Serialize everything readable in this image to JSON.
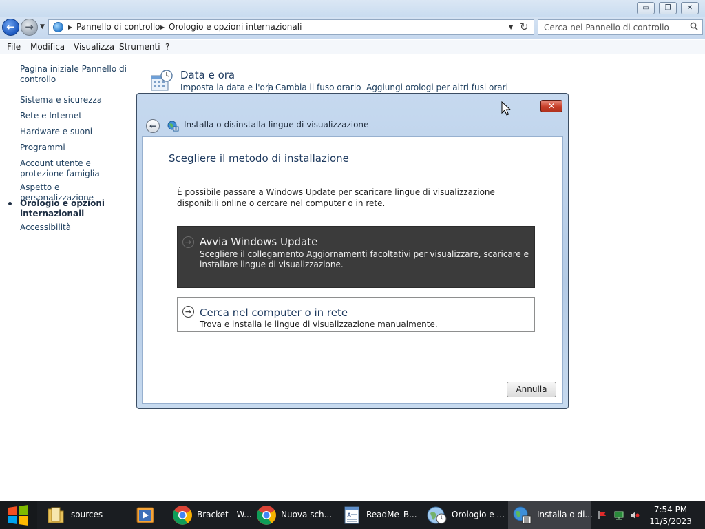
{
  "window": {
    "minimize_glyph": "▭",
    "restore_glyph": "❐",
    "close_glyph": "✕"
  },
  "address_bar": {
    "breadcrumbs": [
      "Pannello di controllo",
      "Orologio e opzioni internazionali"
    ],
    "search_placeholder": "Cerca nel Pannello di controllo"
  },
  "menu": [
    "File",
    "Modifica",
    "Visualizza",
    "Strumenti",
    "?"
  ],
  "sidebar": {
    "items": [
      {
        "label": "Pagina iniziale Pannello di controllo"
      },
      {
        "label": "Sistema e sicurezza"
      },
      {
        "label": "Rete e Internet"
      },
      {
        "label": "Hardware e suoni"
      },
      {
        "label": "Programmi"
      },
      {
        "label": "Account utente e protezione famiglia"
      },
      {
        "label": "Aspetto e personalizzazione"
      },
      {
        "label": "Orologio e opzioni internazionali",
        "active": true
      },
      {
        "label": "Accessibilità"
      }
    ]
  },
  "category": {
    "title": "Data e ora",
    "links": [
      "Imposta la data e l'ora",
      "Cambia il fuso orario",
      "Aggiungi orologi per altri fusi orari"
    ]
  },
  "dialog": {
    "title": "Installa o disinstalla lingue di visualizzazione",
    "heading": "Scegliere il metodo di installazione",
    "description": "È possibile passare a Windows Update per scaricare lingue di visualizzazione disponibili online o cercare nel computer o in rete.",
    "options": [
      {
        "title": "Avvia Windows Update",
        "description": "Scegliere il collegamento Aggiornamenti facoltativi per visualizzare, scaricare e installare lingue di visualizzazione.",
        "highlighted": true
      },
      {
        "title": "Cerca nel computer o in rete",
        "description": "Trova e installa le lingue di visualizzazione manualmente.",
        "highlighted": false
      }
    ],
    "cancel_label": "Annulla"
  },
  "taskbar": {
    "items": [
      {
        "label": "sources",
        "icon": "folder-icon"
      },
      {
        "label": "",
        "icon": "media-player-icon"
      },
      {
        "label": "Bracket - W...",
        "icon": "chrome-icon"
      },
      {
        "label": "Nuova sch...",
        "icon": "chrome-icon"
      },
      {
        "label": "ReadMe_B...",
        "icon": "wordpad-icon"
      },
      {
        "label": "Orologio e ...",
        "icon": "control-panel-clock-icon"
      },
      {
        "label": "Installa o di...",
        "icon": "language-install-icon",
        "active": true
      }
    ],
    "clock": {
      "time": "7:54 PM",
      "date": "11/5/2023"
    }
  },
  "colors": {
    "taskbar": "#1a1d21",
    "dialog_frame": "#b4cbe6",
    "highlight_option": "#3b3b3b",
    "link": "#1e3f5f",
    "close_button": "#c8402a"
  }
}
